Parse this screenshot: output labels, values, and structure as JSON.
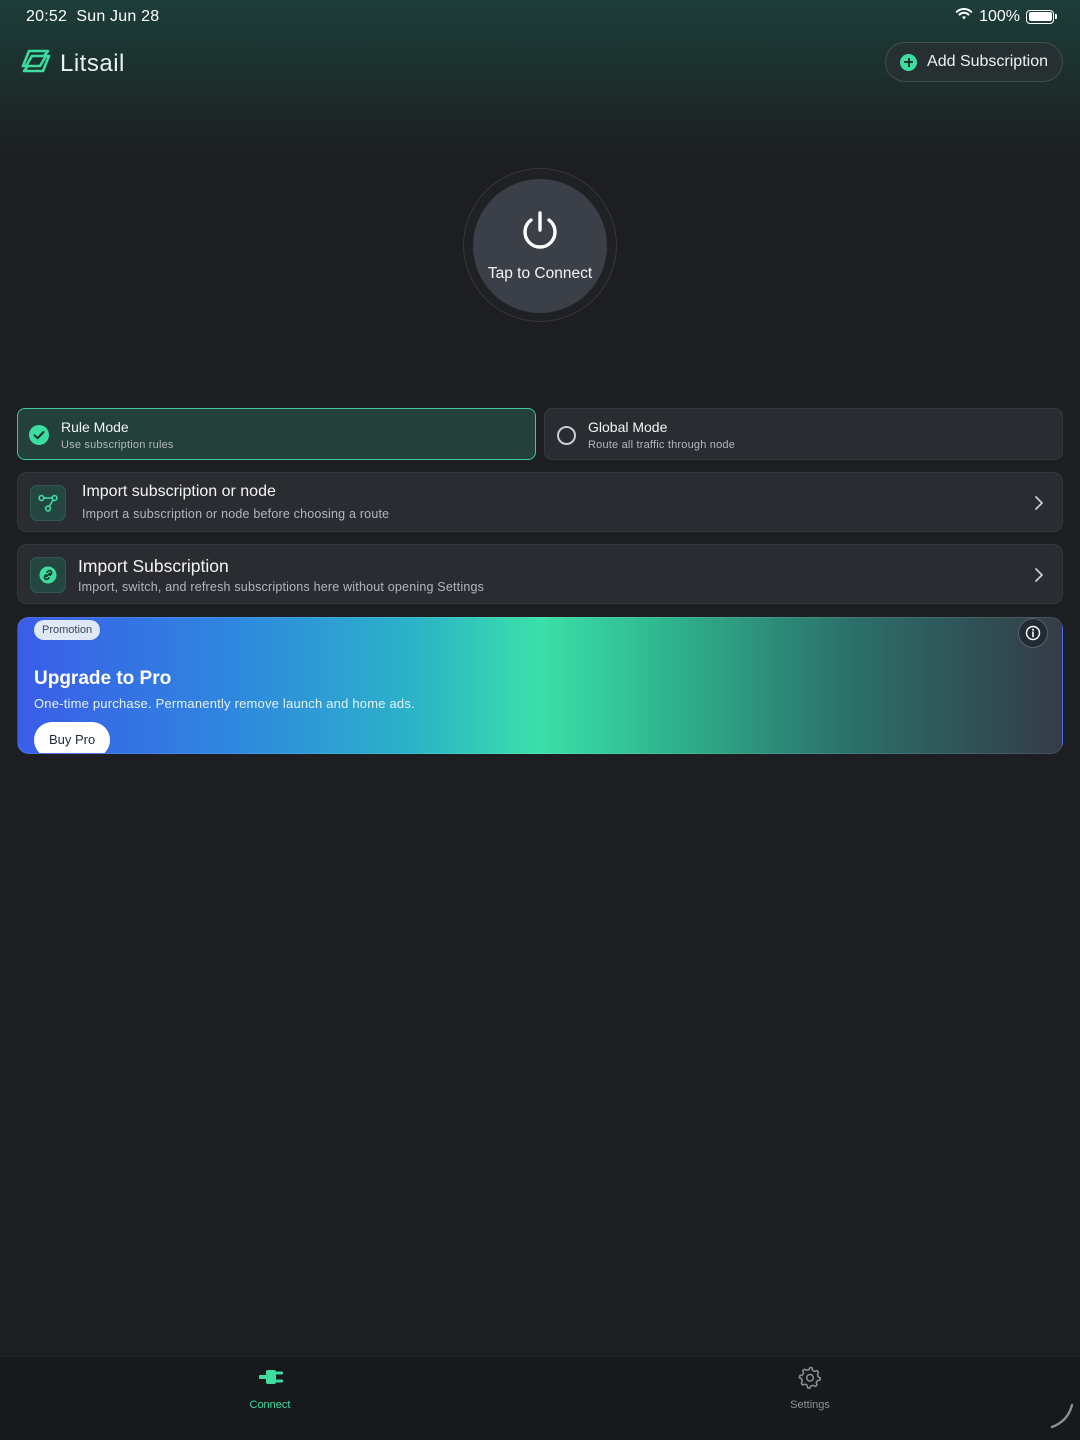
{
  "status_bar": {
    "time": "20:52",
    "date": "Sun Jun 28",
    "battery": "100%",
    "icons": [
      "wifi-icon",
      "battery-icon"
    ]
  },
  "header": {
    "brand": "Litsail",
    "add_subscription_label": "Add Subscription"
  },
  "power": {
    "label": "Tap to Connect"
  },
  "modes": [
    {
      "title": "Rule Mode",
      "subtitle": "Use subscription rules",
      "selected": true
    },
    {
      "title": "Global Mode",
      "subtitle": "Route all traffic through node",
      "selected": false
    }
  ],
  "cards": [
    {
      "title": "Import subscription or node",
      "subtitle": "Import a subscription or node before choosing a route",
      "icon": "nodes-icon"
    },
    {
      "title": "Import Subscription",
      "subtitle": "Import, switch, and refresh subscriptions here without opening Settings",
      "icon": "link-icon"
    }
  ],
  "promo": {
    "badge": "Promotion",
    "title": "Upgrade to Pro",
    "subtitle": "One-time purchase. Permanently remove launch and home ads.",
    "button": "Buy Pro"
  },
  "tabs": [
    {
      "label": "Connect",
      "icon": "plug-icon",
      "active": true
    },
    {
      "label": "Settings",
      "icon": "gear-icon",
      "active": false
    }
  ],
  "colors": {
    "accent": "#3ddc9f",
    "background": "#1d1e22",
    "card": "#2a2c32",
    "selected_card": "#23403a"
  }
}
